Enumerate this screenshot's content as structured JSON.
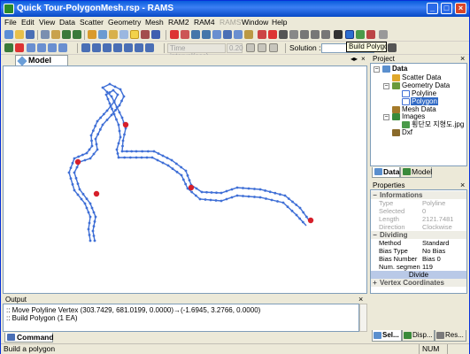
{
  "window": {
    "title": "Quick Tour-PolygonMesh.rsp - RAMS"
  },
  "menu": [
    {
      "label": "File",
      "enabled": true
    },
    {
      "label": "Edit",
      "enabled": true
    },
    {
      "label": "View",
      "enabled": true
    },
    {
      "label": "Data",
      "enabled": true
    },
    {
      "label": "Scatter",
      "enabled": true
    },
    {
      "label": "Geometry",
      "enabled": true
    },
    {
      "label": "Mesh",
      "enabled": true
    },
    {
      "label": "RAM2",
      "enabled": true
    },
    {
      "label": "RAM4",
      "enabled": true
    },
    {
      "label": "RAMS",
      "enabled": false
    },
    {
      "label": "Window",
      "enabled": true
    },
    {
      "label": "Help",
      "enabled": true
    }
  ],
  "toolbar2": {
    "time_interval_label": "Time interval(sec)",
    "time_interval_value": "0.20",
    "solution_label": "Solution :"
  },
  "tooltip": "Build Polygon",
  "model_view": {
    "tab_label": "Model View"
  },
  "output": {
    "title": "Output",
    "lines": [
      ":: Move Polyline Vertex (303.7429, 681.0199, 0.0000)→(-1.6945, 3.2766, 0.0000)",
      ":: Build Polygon (1 EA)"
    ],
    "tab_label": "Command"
  },
  "project": {
    "title": "Project",
    "tree": {
      "root": "Data",
      "scatter": "Scatter Data",
      "geometry": "Geometry Data",
      "polyline": "Polyline",
      "polygon": "Polygon",
      "mesh": "Mesh Data",
      "images": "Images",
      "image_file": "횡단모 지형도.jpg",
      "dxf": "Dxf"
    },
    "tabs": [
      "Data",
      "Model"
    ]
  },
  "properties": {
    "title": "Properties",
    "informations_label": "Informations",
    "informations": [
      {
        "key": "Type",
        "value": "Polyline"
      },
      {
        "key": "Selected",
        "value": "0"
      },
      {
        "key": "Length",
        "value": "2121.7481"
      },
      {
        "key": "Direction",
        "value": "Clockwise"
      }
    ],
    "dividing_label": "Dividing",
    "dividing": [
      {
        "key": "Method",
        "value": "Standard"
      },
      {
        "key": "Bias Type",
        "value": "No Bias"
      },
      {
        "key": "Bias Number",
        "value": "Bias 0"
      },
      {
        "key": "Num. segmen",
        "value": "119"
      }
    ],
    "divide_button": "Divide",
    "vertex_label": "Vertex Coordinates"
  },
  "bottom_tabs": [
    "Sel...",
    "Disp...",
    "Res..."
  ],
  "status": {
    "message": "Build a polygon",
    "indicator": "NUM"
  },
  "colors": {
    "polyline": "#3f6fd6",
    "vertex": "#d61f2a",
    "selection": "#316ac5",
    "titlebar": "#0a5bdc"
  }
}
